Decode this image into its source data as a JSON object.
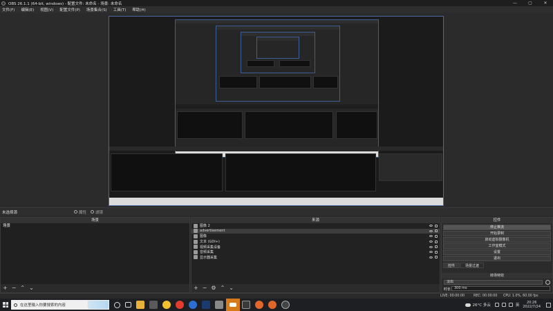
{
  "window": {
    "title": "OBS 26.1.1 (64-bit, windows) - 配置文件: 未命名 - 场景: 未命名",
    "controls": [
      "—",
      "▢",
      "✕"
    ]
  },
  "menu": [
    "文件(F)",
    "编辑(E)",
    "视图(V)",
    "配置文件(P)",
    "场景集合(S)",
    "工具(T)",
    "帮助(H)"
  ],
  "scene_bar": {
    "label": "未选择源",
    "properties": "属性",
    "filters": "滤镜"
  },
  "scenes_dock": {
    "title": "场景",
    "items": [
      "场景"
    ]
  },
  "sources_dock": {
    "title": "来源",
    "items": [
      {
        "name": "图像 2",
        "icon": "image-icon"
      },
      {
        "name": "advertisement",
        "icon": "image-icon",
        "selected": true
      },
      {
        "name": "图像",
        "icon": "image-icon"
      },
      {
        "name": "文本 (GDI+)",
        "icon": "text-icon"
      },
      {
        "name": "视频采集设备",
        "icon": "camera-icon"
      },
      {
        "name": "音频采集",
        "icon": "audio-icon"
      },
      {
        "name": "显示器采集",
        "icon": "monitor-icon"
      }
    ]
  },
  "controls_dock": {
    "title": "控件",
    "buttons": [
      {
        "label": "停止推流",
        "active": true
      },
      {
        "label": "开始录制"
      },
      {
        "label": "启动虚拟摄像机"
      },
      {
        "label": "工作室模式"
      },
      {
        "label": "设置"
      },
      {
        "label": "退出"
      }
    ],
    "tabs": [
      "控件",
      "场景过渡"
    ],
    "transition_title": "转场特效",
    "transition_value": "淡出",
    "duration_label": "时长",
    "duration_value": "300 ms"
  },
  "status": {
    "live": "LIVE: 00:00:00",
    "rec": "REC: 00:00:00",
    "cpu": "CPU: 1.0%, 60.00 fps"
  },
  "taskbar": {
    "search_placeholder": "在这里输入你要搜索的内容",
    "weather": "26°C 多云",
    "time": "20:26",
    "date": "2022/7/24",
    "ime": "英"
  },
  "colors": {
    "accent": "#d77a1a",
    "preview_border": "#4a6aa0"
  }
}
